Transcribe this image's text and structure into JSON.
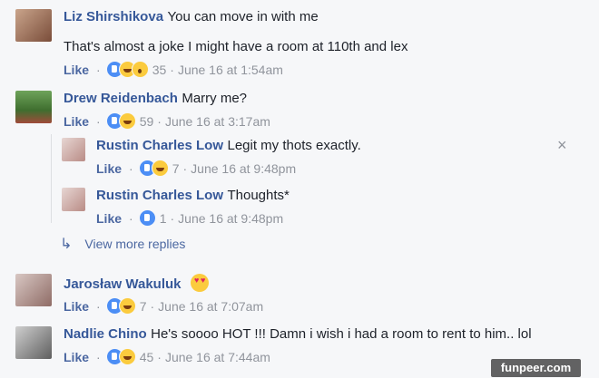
{
  "comments": [
    {
      "name": "Liz Shirshikova",
      "text": "You can move in with me",
      "text2": "That's almost a joke I might have a room at 110th and lex",
      "like": "Like",
      "count": "35",
      "time": "June 16 at 1:54am",
      "reactions": [
        "like",
        "haha",
        "wow"
      ]
    },
    {
      "name": "Drew Reidenbach",
      "text": "Marry me?",
      "like": "Like",
      "count": "59",
      "time": "June 16 at 3:17am",
      "reactions": [
        "like",
        "haha"
      ]
    },
    {
      "name": "Rustin Charles Low",
      "text": "Legit my thots exactly.",
      "like": "Like",
      "count": "7",
      "time": "June 16 at 9:48pm",
      "reactions": [
        "like",
        "haha"
      ]
    },
    {
      "name": "Rustin Charles Low",
      "text": "Thoughts*",
      "like": "Like",
      "count": "1",
      "time": "June 16 at 9:48pm",
      "reactions": [
        "like"
      ]
    },
    {
      "name": "Jarosław Wakuluk",
      "text": "",
      "like": "Like",
      "count": "7",
      "time": "June 16 at 7:07am",
      "reactions": [
        "like",
        "haha"
      ]
    },
    {
      "name": "Nadlie Chino",
      "text": "He's soooo HOT !!! Damn i wish i had a room to rent to him.. lol",
      "like": "Like",
      "count": "45",
      "time": "June 16 at 7:44am",
      "reactions": [
        "like",
        "haha"
      ]
    }
  ],
  "view_more": "View more replies",
  "close_icon": "×",
  "watermark": "funpeer.com",
  "colors": {
    "name": "#365899",
    "meta": "#90949c",
    "background": "#f6f7f9"
  }
}
